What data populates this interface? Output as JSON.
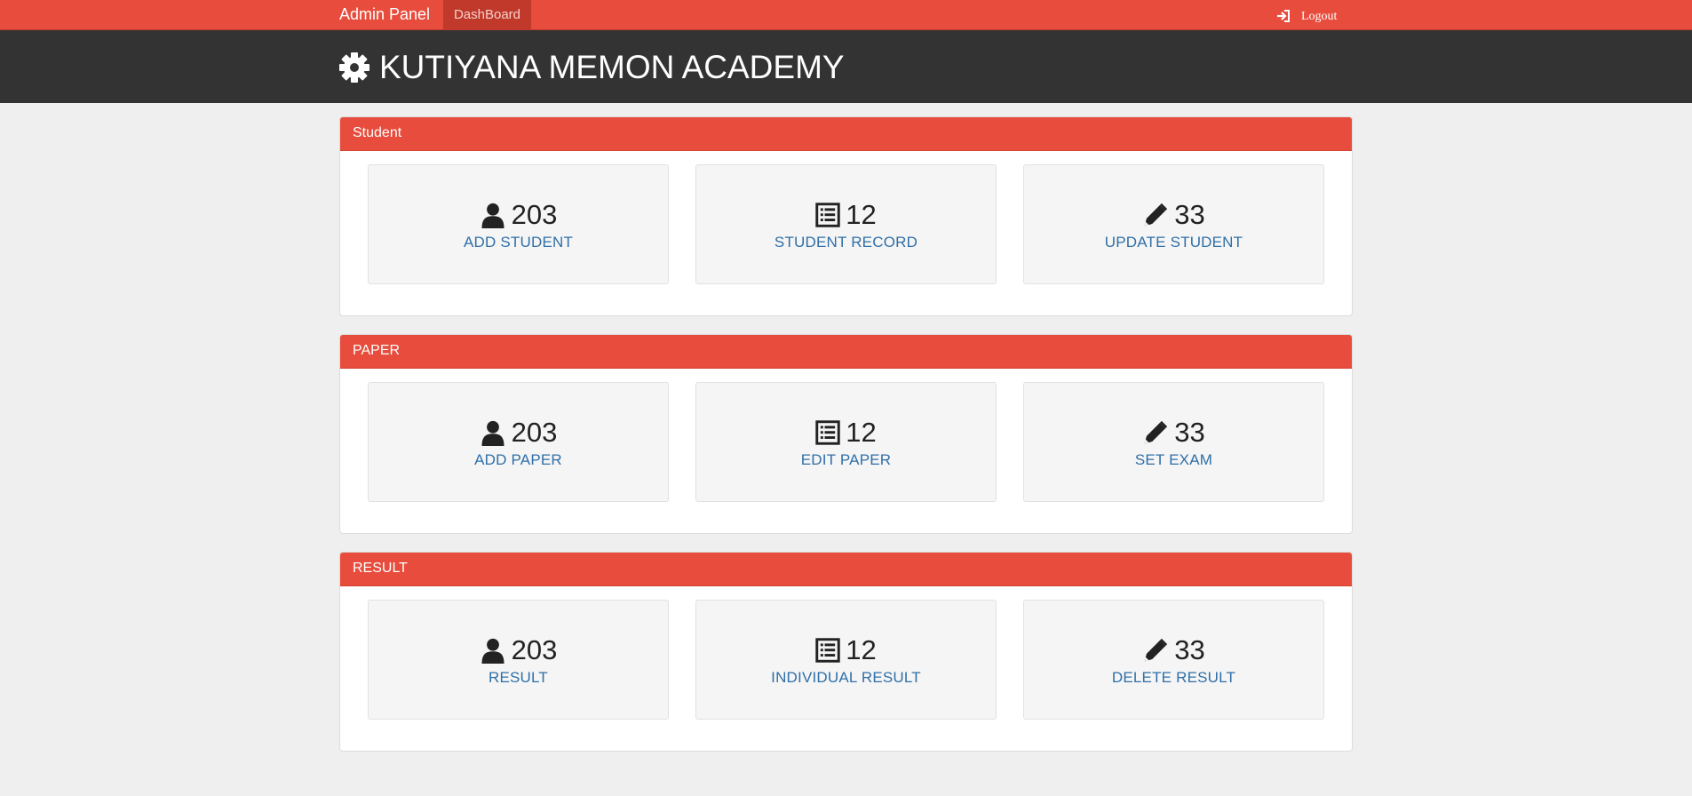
{
  "navbar": {
    "brand": "Admin Panel",
    "dashboard_label": "DashBoard",
    "logout_label": "Logout",
    "accent_color": "#e74c3c"
  },
  "header": {
    "title": "KUTIYANA MEMON ACADEMY",
    "icon": "gear-icon"
  },
  "panels": [
    {
      "heading": "Student",
      "tiles": [
        {
          "icon": "user-icon",
          "count": "203",
          "label": "ADD STUDENT"
        },
        {
          "icon": "list-icon",
          "count": "12",
          "label": "STUDENT RECORD"
        },
        {
          "icon": "pencil-icon",
          "count": "33",
          "label": "UPDATE STUDENT"
        }
      ]
    },
    {
      "heading": "PAPER",
      "tiles": [
        {
          "icon": "user-icon",
          "count": "203",
          "label": "ADD PAPER"
        },
        {
          "icon": "list-icon",
          "count": "12",
          "label": "EDIT PAPER"
        },
        {
          "icon": "pencil-icon",
          "count": "33",
          "label": "SET EXAM"
        }
      ]
    },
    {
      "heading": "RESULT",
      "tiles": [
        {
          "icon": "user-icon",
          "count": "203",
          "label": "RESULT"
        },
        {
          "icon": "list-icon",
          "count": "12",
          "label": "INDIVIDUAL RESULT"
        },
        {
          "icon": "pencil-icon",
          "count": "33",
          "label": "DELETE RESULT"
        }
      ]
    }
  ]
}
